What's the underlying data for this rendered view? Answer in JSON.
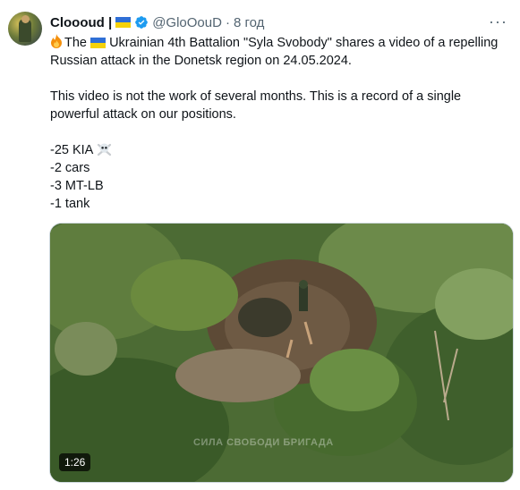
{
  "tweet": {
    "display_name": "Cloooud |",
    "handle": "@GloOouD",
    "separator": "·",
    "time": "8 год",
    "more_label": "···",
    "text_line1_a": "The",
    "text_line1_b": "Ukrainian 4th Battalion \"Syla Svobody\" shares a video of a repelling",
    "text_line2": "Russian attack in the Donetsk region on 24.05.2024.",
    "text_line3": "This video is not the work of several months. This is a record of a single",
    "text_line4": "powerful attack on our positions.",
    "stat1": "-25 KIA",
    "stat2": "-2 cars",
    "stat3": "-3 MT-LB",
    "stat4": "-1 tank"
  },
  "media": {
    "duration": "1:26",
    "watermark": "СИЛА СВОБОДИ   БРИГАДА"
  },
  "colors": {
    "flag_blue": "#2f6fd6",
    "flag_yellow": "#f5d20a",
    "verified_blue": "#1d9bf0",
    "secondary_text": "#536471"
  },
  "icons": {
    "flag": "ukraine-flag-icon",
    "verified": "verified-badge-icon",
    "fire": "fire-emoji-icon",
    "skull": "skull-crossbones-emoji-icon"
  }
}
